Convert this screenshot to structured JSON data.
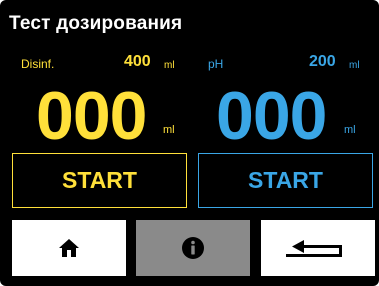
{
  "header": {
    "title": "Тест дозирования"
  },
  "left_channel": {
    "label": "Disinf.",
    "setpoint_value": "400",
    "setpoint_unit": "ml",
    "current_value": "000",
    "current_unit": "ml",
    "start_label": "START",
    "color": "#ffe03a"
  },
  "right_channel": {
    "label": "pH",
    "setpoint_value": "200",
    "setpoint_unit": "ml",
    "current_value": "000",
    "current_unit": "ml",
    "start_label": "START",
    "color": "#3aa6e6"
  },
  "nav": {
    "home_icon": "home-icon",
    "info_icon": "info-icon",
    "back_icon": "return-arrow-icon"
  },
  "colors": {
    "background": "#000000",
    "info_button_bg": "#8a8a8a",
    "nav_button_bg": "#ffffff"
  }
}
